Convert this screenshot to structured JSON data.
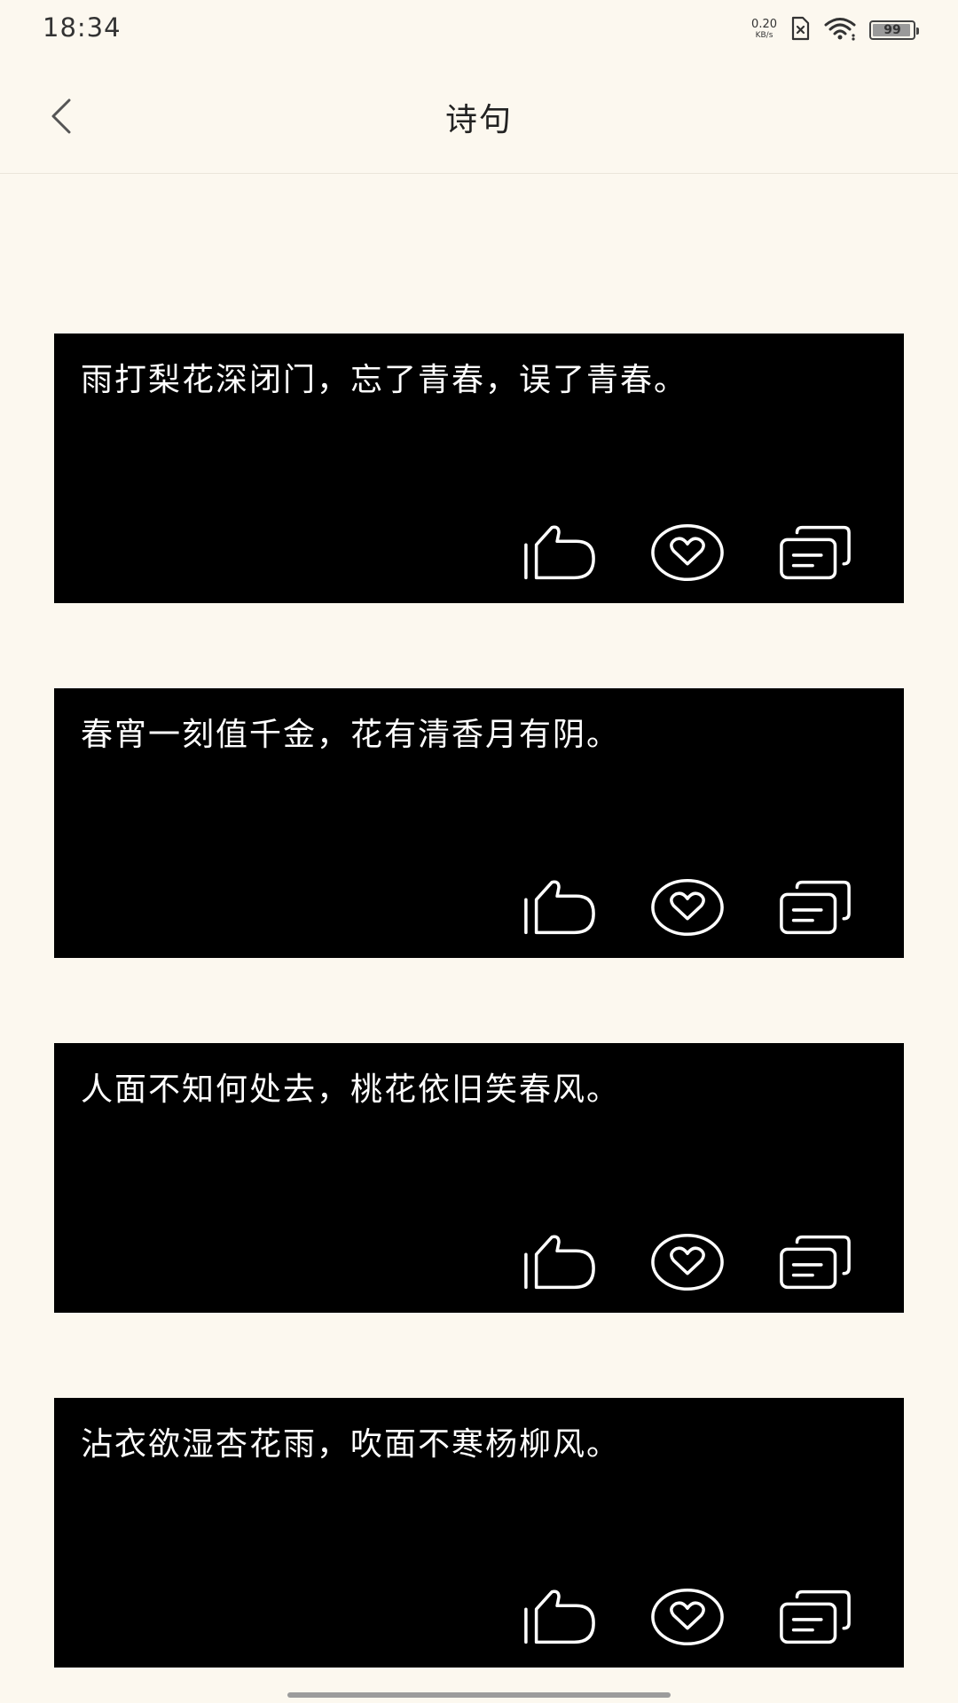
{
  "status_bar": {
    "time": "18:34",
    "net_speed_value": "0.20",
    "net_speed_unit": "KB/s",
    "battery": "99"
  },
  "header": {
    "title": "诗句"
  },
  "poems": [
    {
      "text": "雨打梨花深闭门，忘了青春，误了青春。"
    },
    {
      "text": "春宵一刻值千金，花有清香月有阴。"
    },
    {
      "text": "人面不知何处去，桃花依旧笑春风。"
    },
    {
      "text": "沾衣欲湿杏花雨，吹面不寒杨柳风。"
    }
  ],
  "card_actions": [
    "thumbs-up-icon",
    "heart-icon",
    "copy-icon"
  ],
  "colors": {
    "background": "#fcf8ef",
    "card": "#000000",
    "card_text": "#ffffff"
  }
}
